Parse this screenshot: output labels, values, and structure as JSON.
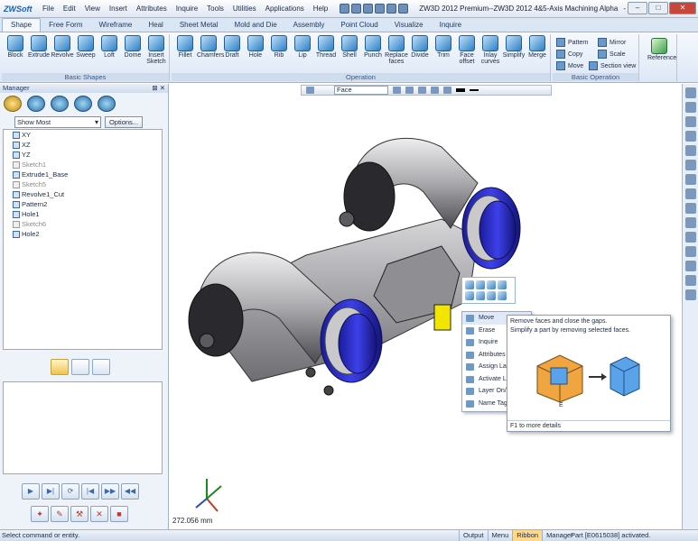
{
  "app": {
    "logo": "ZWSoft",
    "title": "ZW3D 2012 Premium--ZW3D 2012 4&5-Axis Machining Alpha",
    "title_tail": "- Th..."
  },
  "menu": [
    "File",
    "Edit",
    "View",
    "Insert",
    "Attributes",
    "Inquire",
    "Tools",
    "Utilities",
    "Applications",
    "Help"
  ],
  "tabs": [
    "Shape",
    "Free Form",
    "Wireframe",
    "Heal",
    "Sheet Metal",
    "Mold and Die",
    "Assembly",
    "Point Cloud",
    "Visualize",
    "Inquire"
  ],
  "ribbon": {
    "basic_shapes": {
      "label": "Basic Shapes",
      "buttons": [
        "Block",
        "Extrude",
        "Revolve",
        "Sweep",
        "Loft",
        "Dome",
        "Insert Sketch"
      ]
    },
    "operation": {
      "label": "Operation",
      "buttons": [
        "Fillet",
        "Chamfers",
        "Draft",
        "Hole",
        "Rib",
        "Lip",
        "Thread",
        "Shell",
        "Punch",
        "Replace faces",
        "Divide",
        "Trim",
        "Face offset",
        "Inlay curves",
        "Simplify",
        "Merge"
      ]
    },
    "basic_operation": {
      "label": "Basic Operation",
      "items": [
        "Pattern",
        "Mirror",
        "Copy",
        "Scale",
        "Move",
        "Section view"
      ]
    },
    "reference": {
      "label": "Reference"
    }
  },
  "manager": {
    "title": "Manager",
    "show": "Show Most",
    "options": "Options...",
    "tree": [
      {
        "label": "XY",
        "dim": false
      },
      {
        "label": "XZ",
        "dim": false
      },
      {
        "label": "YZ",
        "dim": false
      },
      {
        "label": "Sketch1",
        "dim": true
      },
      {
        "label": "Extrude1_Base",
        "dim": false
      },
      {
        "label": "Sketch5",
        "dim": true
      },
      {
        "label": "Revolve1_Cut",
        "dim": false
      },
      {
        "label": "Pattern2",
        "dim": false
      },
      {
        "label": "Hole1",
        "dim": false
      },
      {
        "label": "Sketch6",
        "dim": true
      },
      {
        "label": "Hole2",
        "dim": false
      }
    ]
  },
  "viewport": {
    "filter": "Face",
    "distance": "272.056 mm"
  },
  "context_menu": [
    "Move",
    "Erase",
    "Inquire",
    "Attributes",
    "Assign Lay...",
    "Activate La...",
    "Layer On/...",
    "Name Tag"
  ],
  "tooltip": {
    "title": "Remove faces and close the gaps.",
    "desc": "Simplify a part by removing selected faces.",
    "label_e": "E",
    "footer": "F1 to more details"
  },
  "status": {
    "message": "Select command or entity.",
    "tabs": [
      "Output",
      "Menu",
      "Ribbon",
      "Manager"
    ],
    "active_tab": "Ribbon",
    "right": "Part [E0615038] activated."
  },
  "colors": {
    "accent": "#2d7fc6",
    "blue_band": "#2d2fd0",
    "model_gray": "#b8b8bc",
    "highlight": "#f2e600"
  }
}
